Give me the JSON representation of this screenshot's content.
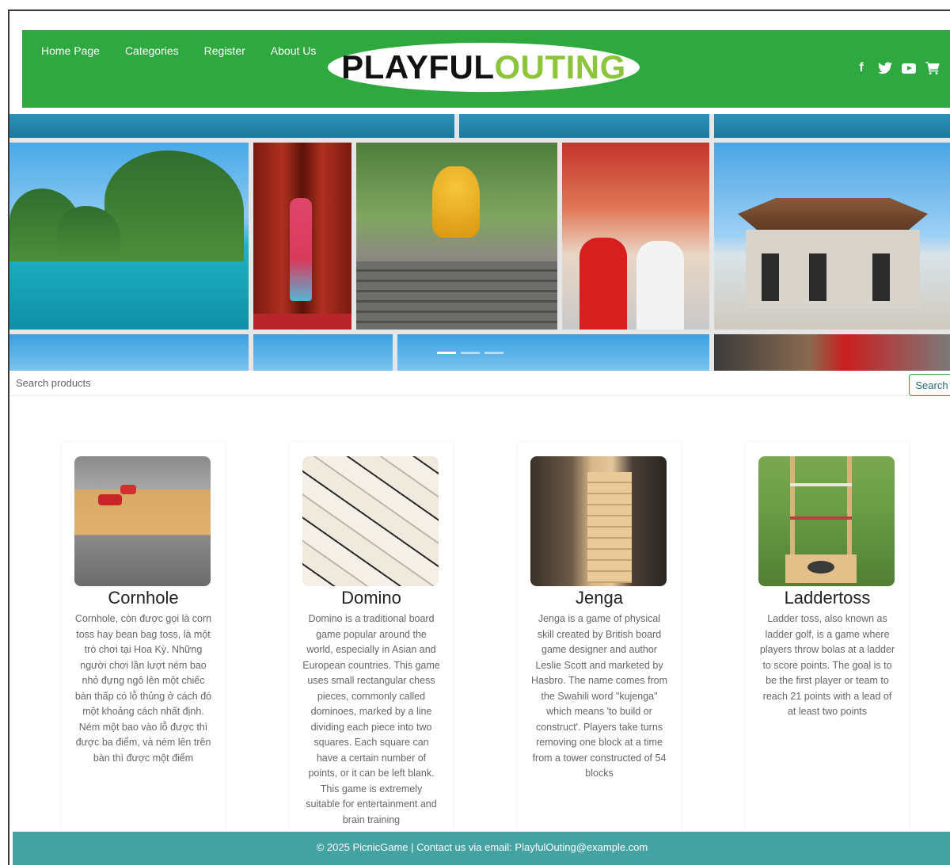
{
  "nav": {
    "home": "Home Page",
    "categories": "Categories",
    "register": "Register",
    "about": "About Us"
  },
  "logo": {
    "part1": "PLAYFUL",
    "part2": "OUTING"
  },
  "social": {
    "icons": [
      "facebook-icon",
      "twitter-icon",
      "youtube-icon",
      "cart-icon"
    ],
    "facebook_glyph": "f",
    "twitter_glyph": "🐦",
    "cart_glyph": "🛒"
  },
  "search": {
    "placeholder": "Search products",
    "button_label": "Search"
  },
  "products": [
    {
      "name": "Cornhole",
      "description": "Cornhole, còn được gọi là corn toss hay bean bag toss, là một trò chơi tại Hoa Kỳ. Những người chơi lần lượt ném bao nhỏ đựng ngô lên một chiếc bàn thấp có lỗ thủng ở cách đó một khoảng cách nhất định. Ném một bao vào lỗ được thì được ba điểm, và ném lên trên bàn thì được một điểm"
    },
    {
      "name": "Domino",
      "description": "Domino is a traditional board game popular around the world, especially in Asian and European countries. This game uses small rectangular chess pieces, commonly called dominoes, marked by a line dividing each piece into two squares. Each square can have a certain number of points, or it can be left blank. This game is extremely suitable for entertainment and brain training"
    },
    {
      "name": "Jenga",
      "description": "Jenga is a game of physical skill created by British board game designer and author Leslie Scott and marketed by Hasbro. The name comes from the Swahili word \"kujenga\" which means 'to build or construct'. Players take turns removing one block at a time from a tower constructed of 54 blocks"
    },
    {
      "name": "Laddertoss",
      "description": "Ladder toss, also known as ladder golf, is a game where players throw bolas at a ladder to score points. The goal is to be the first player or team to reach 21 points with a lead of at least two points"
    }
  ],
  "footer": {
    "text": "© 2025 PicnicGame | Contact us via email: PlayfulOuting@example.com"
  },
  "colors": {
    "header_green": "#2ea83f",
    "logo_accent": "#8cc43c",
    "footer_teal": "#45a2a2"
  }
}
